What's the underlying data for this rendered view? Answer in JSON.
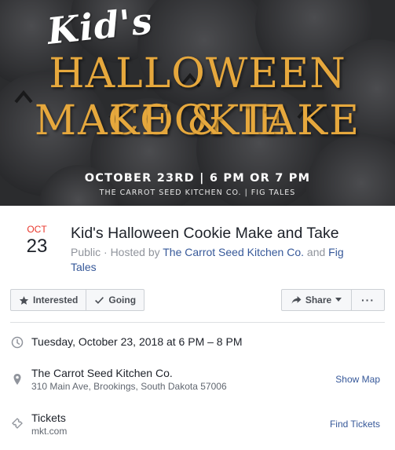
{
  "banner": {
    "script_title": "Kid's",
    "headline_line1": "HALLOWEEN COOKIE",
    "headline_line2": "MAKE & TAKE",
    "date_line": "OCTOBER 23RD | 6 PM OR 7 PM",
    "sub_line": "THE CARROT SEED KITCHEN CO. | FIG TALES"
  },
  "event": {
    "month": "OCT",
    "day": "23",
    "title": "Kid's Halloween Cookie Make and Take",
    "privacy": "Public · Hosted by ",
    "host1": "The Carrot Seed Kitchen Co.",
    "host_sep": " and ",
    "host2": "Fig Tales"
  },
  "actions": {
    "interested": "Interested",
    "going": "Going",
    "share": "Share",
    "more": "···"
  },
  "details": {
    "datetime": "Tuesday, October 23, 2018 at 6 PM – 8 PM",
    "venue": "The Carrot Seed Kitchen Co.",
    "address": "310 Main Ave, Brookings, South Dakota 57006",
    "show_map": "Show Map",
    "tickets_label": "Tickets",
    "tickets_site": "mkt.com",
    "find_tickets": "Find Tickets"
  },
  "colors": {
    "accent_link": "#365899",
    "month_red": "#e8362b",
    "banner_orange": "#e6a83d"
  }
}
